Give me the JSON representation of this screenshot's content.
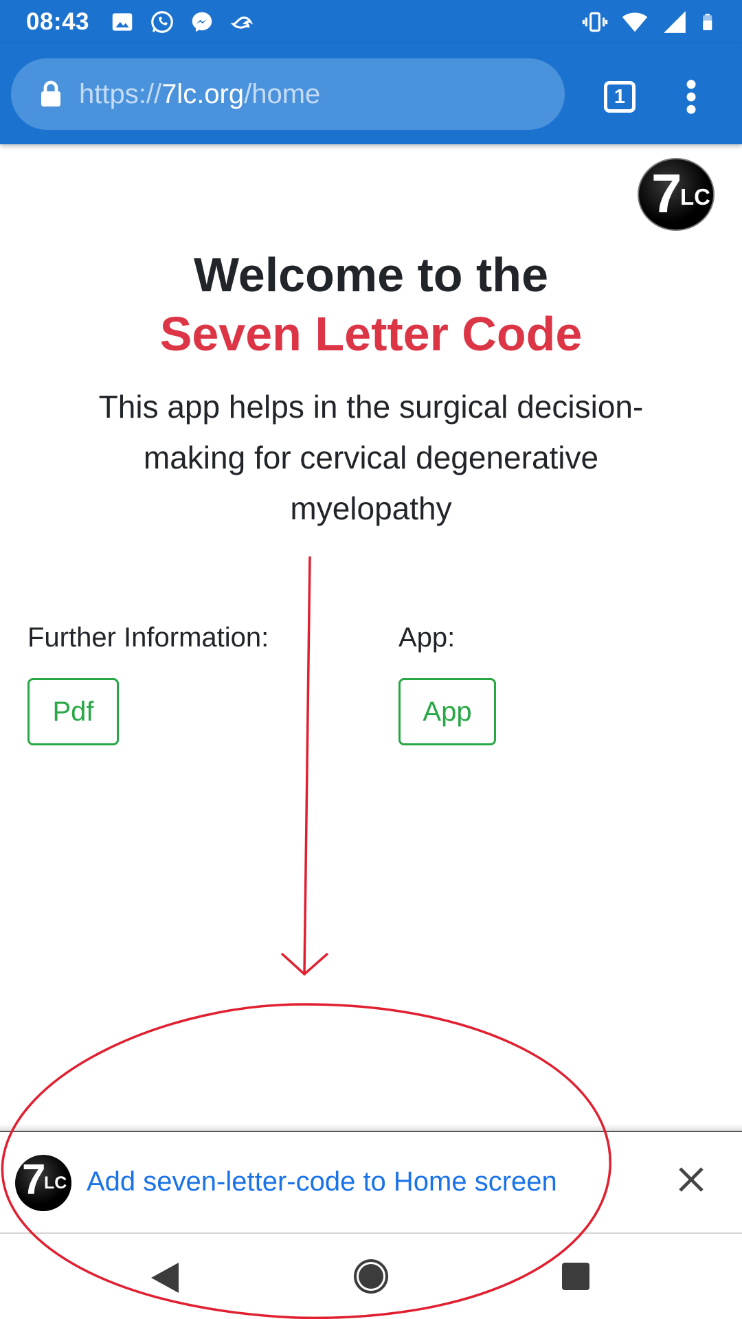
{
  "status_bar": {
    "time": "08:43",
    "left_icons": [
      "image-icon",
      "whatsapp-icon",
      "messenger-icon",
      "crowdstrike-icon"
    ],
    "right_icons": [
      "vibrate-icon",
      "wifi-icon",
      "signal-icon",
      "battery-icon"
    ]
  },
  "browser": {
    "url_scheme": "https://",
    "url_host": "7lc.org",
    "url_path": "/home",
    "tab_count": "1",
    "colors": {
      "toolbar": "#1c72cf",
      "url_pill": "#4a92dc"
    }
  },
  "logo": {
    "seven": "7",
    "lc": "LC"
  },
  "page": {
    "welcome": "Welcome to the",
    "brand": "Seven Letter Code",
    "intro": "This app helps in the surgical decision-making for cervical degenerative myelopathy",
    "info_label": "Further Information:",
    "pdf_button": "Pdf",
    "app_label": "App:",
    "app_button": "App",
    "colors": {
      "brand": "#dc3545",
      "button": "#28a745"
    }
  },
  "install_banner": {
    "text": "Add seven-letter-code to Home screen",
    "color": "#1a73e8"
  },
  "annotation": {
    "color": "#e02030"
  }
}
